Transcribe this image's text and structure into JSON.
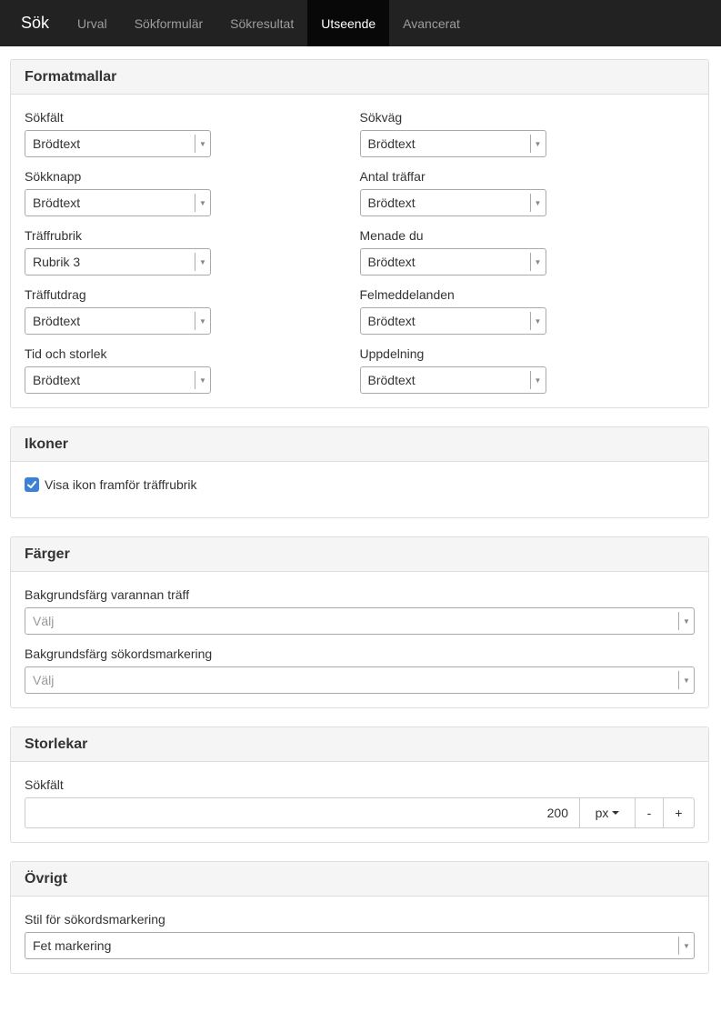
{
  "nav": {
    "brand": "Sök",
    "tabs": [
      {
        "label": "Urval"
      },
      {
        "label": "Sökformulär"
      },
      {
        "label": "Sökresultat"
      },
      {
        "label": "Utseende"
      },
      {
        "label": "Avancerat"
      }
    ],
    "active_tab": "Utseende"
  },
  "formatmallar": {
    "title": "Formatmallar",
    "left": [
      {
        "label": "Sökfält",
        "value": "Brödtext"
      },
      {
        "label": "Sökknapp",
        "value": "Brödtext"
      },
      {
        "label": "Träffrubrik",
        "value": "Rubrik 3"
      },
      {
        "label": "Träffutdrag",
        "value": "Brödtext"
      },
      {
        "label": "Tid och storlek",
        "value": "Brödtext"
      }
    ],
    "right": [
      {
        "label": "Sökväg",
        "value": "Brödtext"
      },
      {
        "label": "Antal träffar",
        "value": "Brödtext"
      },
      {
        "label": "Menade du",
        "value": "Brödtext"
      },
      {
        "label": "Felmeddelanden",
        "value": "Brödtext"
      },
      {
        "label": "Uppdelning",
        "value": "Brödtext"
      }
    ]
  },
  "ikoner": {
    "title": "Ikoner",
    "checkbox_label": "Visa ikon framför träffrubrik",
    "checked": true
  },
  "farger": {
    "title": "Färger",
    "fields": [
      {
        "label": "Bakgrundsfärg varannan träff",
        "placeholder": "Välj"
      },
      {
        "label": "Bakgrundsfärg sökordsmarkering",
        "placeholder": "Välj"
      }
    ]
  },
  "storlekar": {
    "title": "Storlekar",
    "field_label": "Sökfält",
    "value": "200",
    "unit": "px",
    "minus": "-",
    "plus": "+"
  },
  "ovrigt": {
    "title": "Övrigt",
    "field_label": "Stil för sökordsmarkering",
    "value": "Fet markering"
  },
  "colors": {
    "navbar": "#222222",
    "active_tab": "#080808",
    "checkbox": "#3b82d6"
  }
}
